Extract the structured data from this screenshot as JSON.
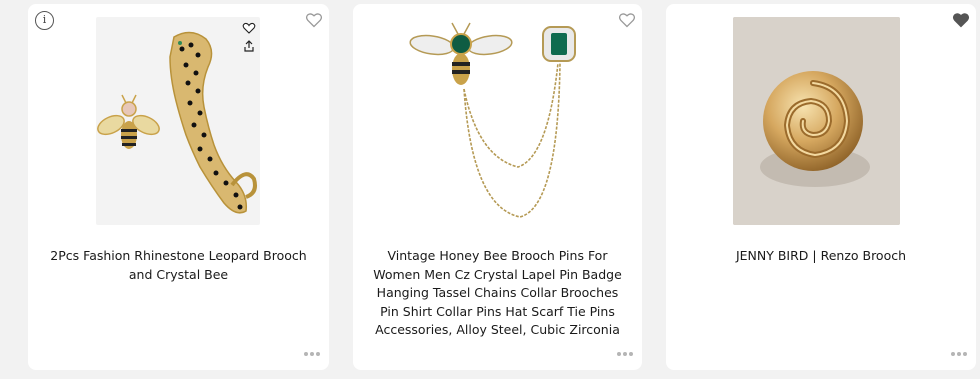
{
  "products": [
    {
      "title": "2Pcs Fashion Rhinestone Leopard Brooch and Crystal Bee",
      "favorited": false,
      "icons": [
        "info-icon",
        "heart-outline-icon",
        "more-dots-icon",
        "small-heart-icon",
        "share-icon"
      ]
    },
    {
      "title": "Vintage Honey Bee Brooch Pins For Women Men Cz Crystal Lapel Pin Badge Hanging Tassel Chains Collar Brooches Pin Shirt Collar Pins Hat Scarf Tie Pins Accessories, Alloy Steel, Cubic Zirconia",
      "favorited": false,
      "icons": [
        "heart-outline-icon",
        "more-dots-icon"
      ]
    },
    {
      "title": "JENNY BIRD | Renzo Brooch",
      "favorited": true,
      "icons": [
        "heart-filled-icon",
        "more-dots-icon"
      ]
    }
  ],
  "info_glyph": "i",
  "colors": {
    "page_bg": "#f2f2f2",
    "card_bg": "#ffffff",
    "heart_outline": "#9a9a9a",
    "heart_filled": "#555555",
    "gold": "#c9a24a"
  }
}
